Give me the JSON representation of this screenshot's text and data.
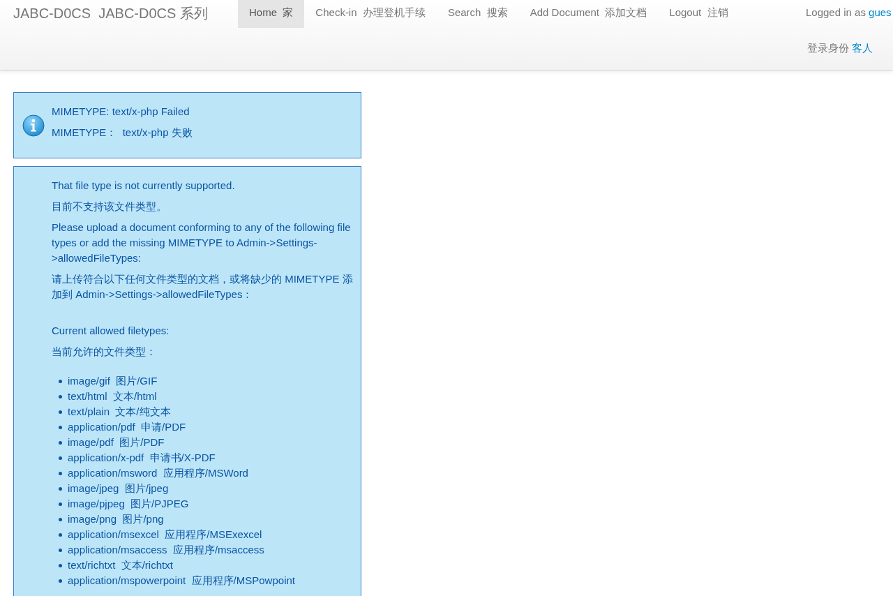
{
  "navbar": {
    "brand": "JABC-D0CS  JABC-D0CS 系列",
    "items": [
      {
        "label": "Home  家",
        "selected": true
      },
      {
        "label": "Check-in  办理登机手续",
        "selected": false
      },
      {
        "label": "Search  搜索",
        "selected": false
      },
      {
        "label": "Add Document  添加文档",
        "selected": false
      },
      {
        "label": "Logout  注销",
        "selected": false
      }
    ],
    "user_lines": [
      {
        "prefix": "Logged in as",
        "name": "gues"
      },
      {
        "prefix": "登录身份",
        "name": "客人"
      }
    ]
  },
  "alerts": [
    {
      "kind": "info",
      "lines": [
        "MIMETYPE: text/x-php Failed",
        "MIMETYPE：  text/x-php 失败"
      ]
    },
    {
      "kind": "detail",
      "sections": [
        [
          "That file type is not currently supported.",
          "目前不支持该文件类型。",
          "Please upload a document conforming to any of the following file types or add the missing MIMETYPE to Admin->Settings->allowedFileTypes:",
          "请上传符合以下任何文件类型的文档，或将缺少的 MIMETYPE 添加到 Admin->Settings->allowedFileTypes："
        ],
        [
          "Current allowed filetypes:",
          "当前允许的文件类型："
        ]
      ],
      "filetypes": [
        "image/gif  图片/GIF",
        "text/html  文本/html",
        "text/plain  文本/纯文本",
        "application/pdf  申请/PDF",
        "image/pdf  图片/PDF",
        "application/x-pdf  申请书/X-PDF",
        "application/msword  应用程序/MSWord",
        "image/jpeg  图片/jpeg",
        "image/pjpeg  图片/PJPEG",
        "image/png  图片/png",
        "application/msexcel  应用程序/MSExexcel",
        "application/msaccess  应用程序/msaccess",
        "text/richtxt  文本/richtxt",
        "application/mspowerpoint  应用程序/MSPowpoint"
      ]
    }
  ]
}
